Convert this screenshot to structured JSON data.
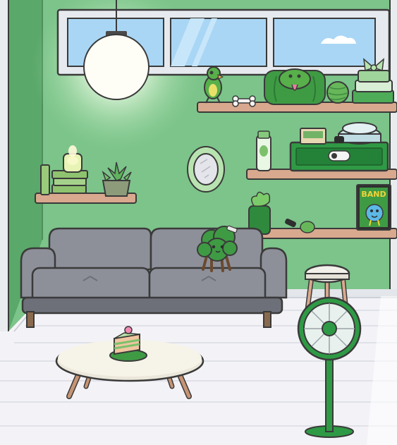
{
  "scene": {
    "title": "",
    "room_colors": {
      "wall": "#7cc48a",
      "wall_dark": "#5aa86a",
      "trim": "#e9ecef",
      "floor": "#f3f3f7",
      "floor_lines": "#d9dbe3",
      "shelf": "#d8a98e",
      "sofa": "#8d9099",
      "sofa_dark": "#6e7079",
      "green_accent": "#2f9a45",
      "lamp_glow": "#fffbe6"
    },
    "comic_book": {
      "title_text": "BAND"
    },
    "items": {
      "window": "window",
      "ceiling_lamp": "pendant-lamp",
      "parrot": "parrot-toy",
      "bone": "dog-bone",
      "frog_bag": "frog-backpack",
      "yarn": "yarn-ball",
      "clothes_stack": "folded-clothes-with-bow",
      "lotion": "lotion-bottle",
      "cereal": "cereal-box",
      "bowl": "lidded-bowl",
      "toolbox": "green-toolbox",
      "candle": "jar-candle",
      "books": "book-stack",
      "plant": "succulent-pot",
      "mirror": "hand-mirror",
      "cactus_cup": "plant-cup",
      "whistle": "party-whistle",
      "comic": "comic-book",
      "sofa": "gray-sofa",
      "broccoli": "broccoli-character",
      "stool": "bar-stool",
      "fan": "standing-fan",
      "coffee_table": "coffee-table",
      "cake": "cake-slice"
    }
  }
}
